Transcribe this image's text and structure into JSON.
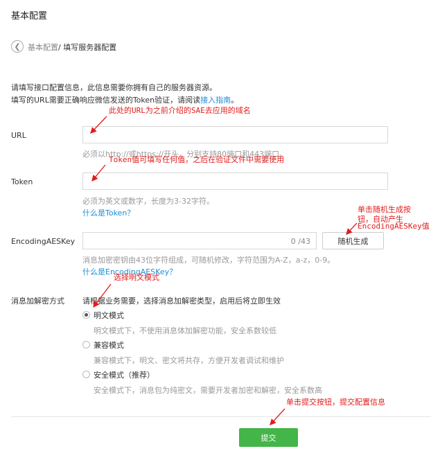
{
  "page_title": "基本配置",
  "breadcrumb": {
    "parent": "基本配置",
    "current": "/ 填写服务器配置"
  },
  "intro": {
    "line1": "请填写接口配置信息，此信息需要你拥有自己的服务器资源。",
    "line2_prefix": "填写的URL需要正确响应微信发送的Token验证，请阅读",
    "line2_link": "接入指南",
    "line2_suffix": "。"
  },
  "url": {
    "label": "URL",
    "value": "",
    "hint": "必须以http://或https://开头，分别支持80端口和443端口。"
  },
  "token": {
    "label": "Token",
    "value": "",
    "hint": "必须为英文或数字，长度为3-32字符。",
    "link": "什么是Token？"
  },
  "aes": {
    "label": "EncodingAESKey",
    "value": "",
    "counter": "0 /43",
    "random_button": "随机生成",
    "hint": "消息加密密钥由43位字符组成，可随机修改，字符范围为A-Z，a-z，0-9。",
    "link": "什么是EncodingAESKey？"
  },
  "encryption": {
    "label": "消息加解密方式",
    "description": "请根据业务需要，选择消息加解密类型，启用后将立即生效",
    "options": [
      {
        "label": "明文模式",
        "desc": "明文模式下，不使用消息体加解密功能，安全系数较低",
        "checked": true
      },
      {
        "label": "兼容模式",
        "desc": "兼容模式下，明文、密文将共存，方便开发者调试和维护",
        "checked": false
      },
      {
        "label": "安全模式（推荐）",
        "desc": "安全模式下，消息包为纯密文，需要开发者加密和解密，安全系数高",
        "checked": false
      }
    ]
  },
  "submit_button": "提交",
  "annotations": {
    "url_note": "此处的URL为之前介绍的SAE去应用的域名",
    "token_note": "Token值可填写任何值，之后在验证文件中需要使用",
    "random_note_1": "单击随机生成按",
    "random_note_2": "钮，自动产生",
    "random_note_3": "EncodingAESKey值",
    "mode_note": "选择明文模式",
    "submit_note": "单击提交按钮，提交配置信息"
  },
  "colors": {
    "accent_green": "#44b549",
    "link_blue": "#1c8cd9",
    "annotation_red": "#e41b1b"
  }
}
